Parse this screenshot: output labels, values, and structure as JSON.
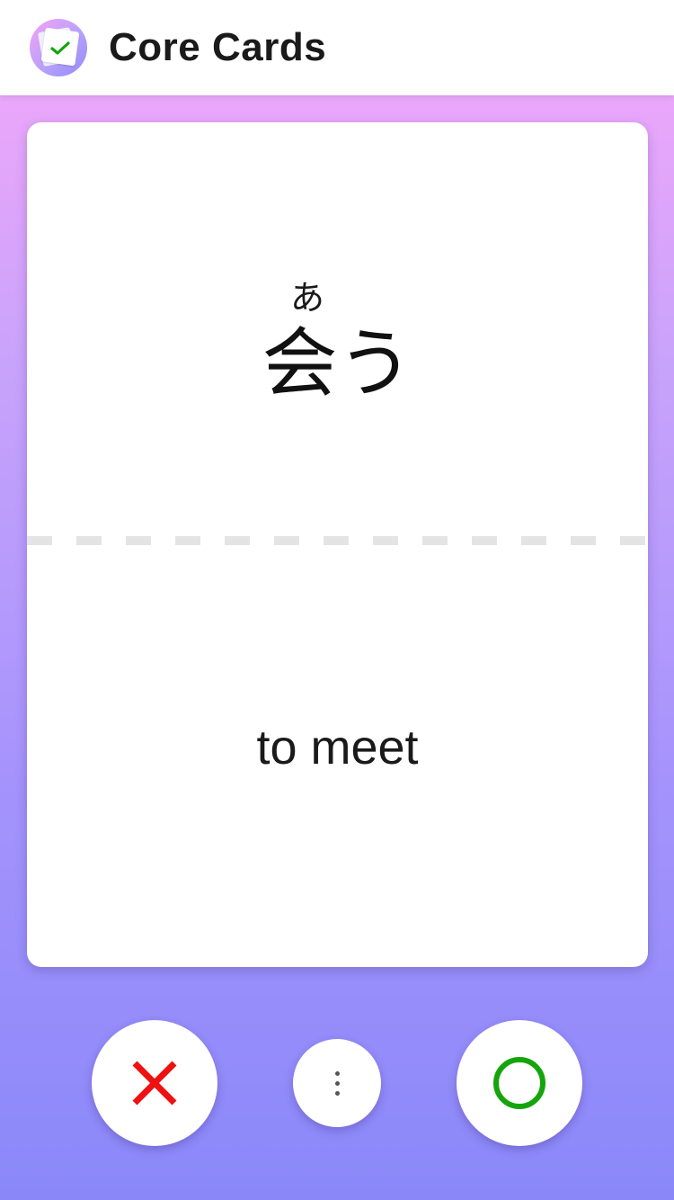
{
  "header": {
    "title": "Core Cards",
    "logo_icon": "flashcard-check-icon"
  },
  "card": {
    "reading": "あ",
    "term": "会う",
    "meaning": "to meet"
  },
  "actions": {
    "wrong_icon": "cross-icon",
    "more_icon": "vertical-ellipsis-icon",
    "right_icon": "circle-icon"
  },
  "colors": {
    "background_top": "#f7a8fa",
    "background_bottom": "#8a88f9",
    "wrong": "#ee1111",
    "right": "#14a50c",
    "check": "#14a50c"
  }
}
